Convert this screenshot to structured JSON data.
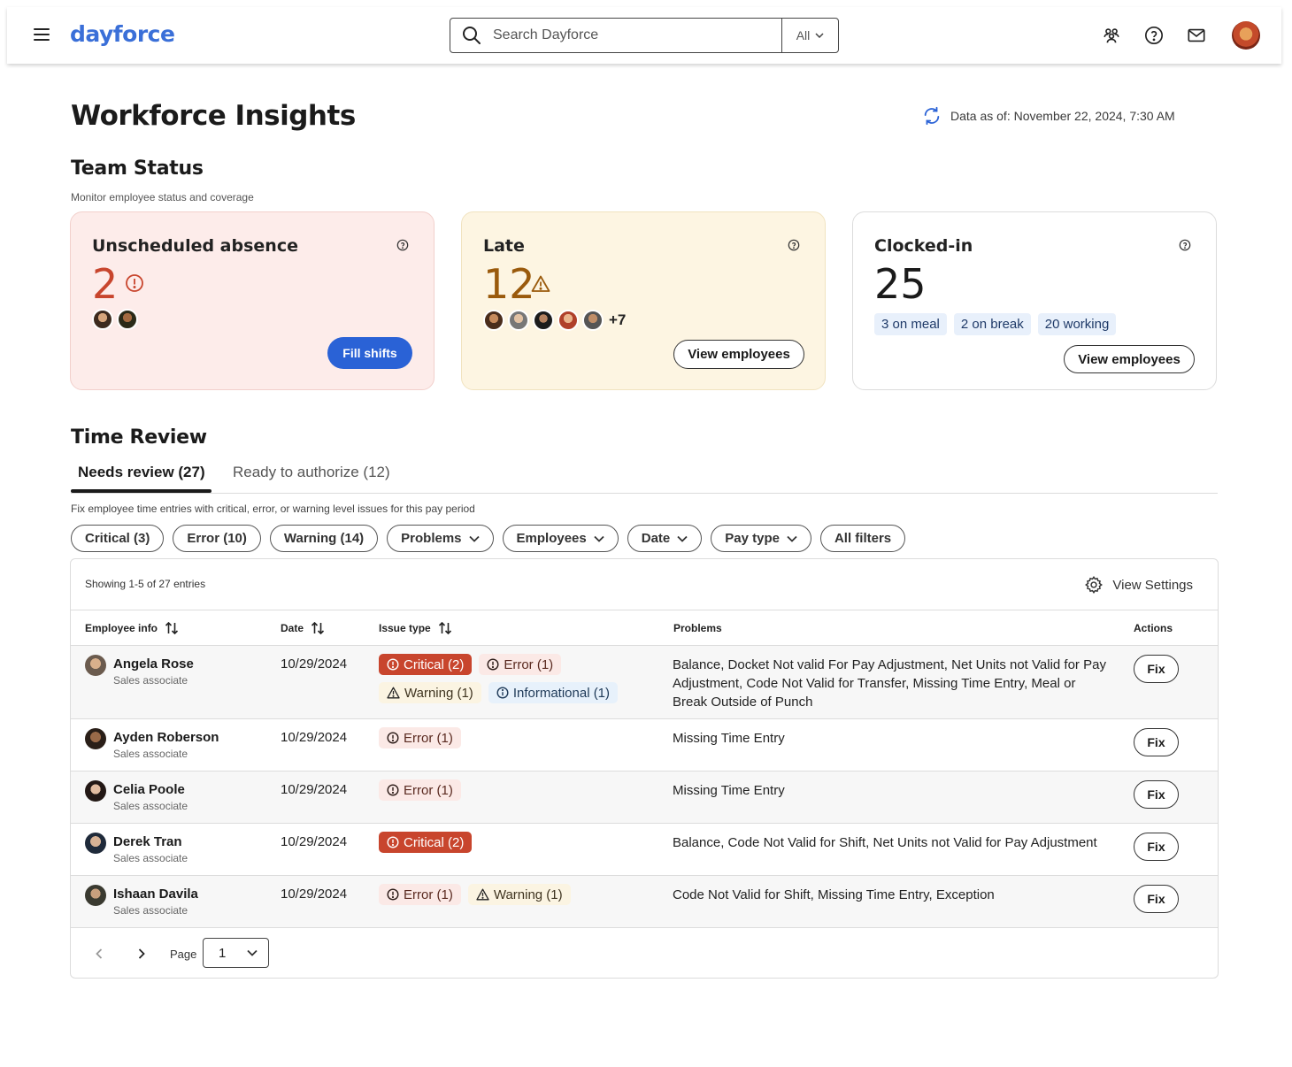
{
  "header": {
    "logo": "dayforce",
    "search": {
      "placeholder": "Search Dayforce",
      "scope": "All"
    },
    "icons": [
      "menu-icon",
      "search-icon",
      "people-icon",
      "help-icon",
      "mail-icon",
      "avatar"
    ]
  },
  "page": {
    "title": "Workforce Insights",
    "data_as_of": "Data as of: November 22, 2024, 7:30 AM"
  },
  "team_status": {
    "title": "Team Status",
    "subtitle": "Monitor employee status and coverage",
    "cards": {
      "absence": {
        "title": "Unscheduled absence",
        "count": "2",
        "action": "Fill shifts",
        "icon": "alert-circle-icon"
      },
      "late": {
        "title": "Late",
        "count": "12",
        "more": "+7",
        "action": "View employees",
        "icon": "warning-triangle-icon"
      },
      "clocked": {
        "title": "Clocked-in",
        "count": "25",
        "chips": [
          "3 on meal",
          "2 on break",
          "20 working"
        ],
        "action": "View employees"
      }
    }
  },
  "time_review": {
    "title": "Time Review",
    "tabs": {
      "active": "Needs review (27)",
      "inactive": "Ready to authorize (12)"
    },
    "description": "Fix employee time entries with critical, error, or warning level issues for this pay period",
    "filters": [
      "Critical (3)",
      "Error (10)",
      "Warning (14)",
      "Problems",
      "Employees",
      "Date",
      "Pay type",
      "All filters"
    ],
    "table": {
      "showing": "Showing 1-5 of 27 entries",
      "view_settings": "View Settings",
      "columns": {
        "employee": "Employee info",
        "date": "Date",
        "issue": "Issue type",
        "problems": "Problems",
        "actions": "Actions"
      },
      "rows": [
        {
          "name": "Angela Rose",
          "role": "Sales associate",
          "date": "10/29/2024",
          "issues": [
            "Critical (2)",
            "Error (1)",
            "Warning (1)",
            "Informational (1)"
          ],
          "problems": "Balance, Docket Not valid For Pay Adjustment, Net Units not Valid for Pay Adjustment, Code Not Valid for Transfer, Missing Time Entry, Meal or Break Outside of Punch",
          "action": "Fix"
        },
        {
          "name": "Ayden Roberson",
          "role": "Sales associate",
          "date": "10/29/2024",
          "issues": [
            "Error (1)"
          ],
          "problems": "Missing Time Entry",
          "action": "Fix"
        },
        {
          "name": "Celia Poole",
          "role": "Sales associate",
          "date": "10/29/2024",
          "issues": [
            "Error (1)"
          ],
          "problems": "Missing Time Entry",
          "action": "Fix"
        },
        {
          "name": "Derek Tran",
          "role": "Sales associate",
          "date": "10/29/2024",
          "issues": [
            "Critical (2)"
          ],
          "problems": "Balance, Code Not Valid for Shift, Net Units not Valid for Pay Adjustment",
          "action": "Fix"
        },
        {
          "name": "Ishaan Davila",
          "role": "Sales associate",
          "date": "10/29/2024",
          "issues": [
            "Error (1)",
            "Warning (1)"
          ],
          "problems": "Code Not Valid for Shift, Missing Time Entry, Exception",
          "action": "Fix"
        }
      ]
    },
    "pagination": {
      "label": "Page",
      "current": "1"
    }
  },
  "colors": {
    "brand": "#3a6fd8",
    "primary_button": "#2a62d6",
    "critical": "#c8452d",
    "absence_card": "#fdecea",
    "late_card": "#fdf5e2",
    "late_count": "#9a5a0c"
  }
}
